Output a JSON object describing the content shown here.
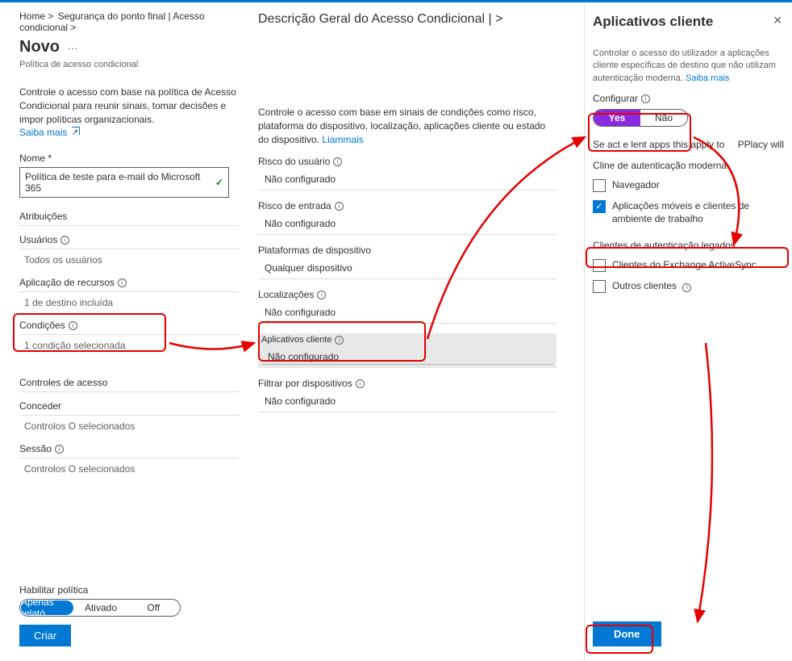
{
  "breadcrumb": {
    "home": "Home >",
    "seg": "Segurança do ponto final | Acesso condicional >",
    "overview": "Descrição Geral do Acesso Condicional | >"
  },
  "header": {
    "novo": "Novo",
    "more": "···",
    "subtitle": "Política de acesso condicional"
  },
  "left": {
    "intro": "Controle o acesso com base na política de Acesso Condicional para reunir sinais, tomar decisões e impor políticas organizacionais.",
    "learn": "Saiba mais",
    "name_label": "Nome *",
    "name_value": "Política de teste para e-mail do Microsoft 365",
    "atrib": "Atribuições",
    "users_t": "Usuários",
    "users_v": "Todos os usuários",
    "app_t": "Aplicação de recursos",
    "app_v": "1 de destino incluída",
    "cond_t": "Condições",
    "cond_v": "1 condição selecionada",
    "acc": "Controles de acesso",
    "grant_t": "Conceder",
    "grant_v": "Controlos O selecionados",
    "sess_t": "Sessão",
    "sess_v": "Controlos O selecionados"
  },
  "mid": {
    "intro": "Controle o acesso com base em sinais de condições como risco, plataforma do dispositivo, localização, aplicações cliente ou estado do dispositivo.",
    "learn": "Liammais",
    "risk_u_t": "Risco do usuário",
    "risk_u_v": "Não configurado",
    "risk_s_t": "Risco de entrada",
    "risk_s_v": "Não configurado",
    "plat_t": "Plataformas de dispositivo",
    "plat_v": "Qualquer dispositivo",
    "loc_t": "Localizações",
    "loc_v": "Não configurado",
    "client_t": "Aplicativos cliente",
    "client_v": "Não configurado",
    "filter_t": "Filtrar por dispositivos",
    "filter_v": "Não configurado"
  },
  "right": {
    "title": "Aplicativos cliente",
    "desc": "Controlar o acesso do utilizador a aplicações cliente específicas de destino que não utilizam autenticação moderna.",
    "learn": "Saiba mais",
    "cfg_label": "Configurar",
    "yes": "Yes",
    "no": "Não",
    "apply_l": "Se act e lent apps this apply to",
    "apply_r": "PPlacy will",
    "modern": "Cline de autenticação moderna",
    "cb_browser": "Navegador",
    "cb_mobile": "Aplicações móveis e clientes de ambiente de trabalho",
    "legacy": "Clientes de autenticação legados",
    "cb_eas": "Clientes do Exchange ActiveSync",
    "cb_other": "Outros clientes",
    "done": "Done"
  },
  "bottom": {
    "enable": "Habilitar política",
    "opt1": "Apenas relató",
    "opt2": "Ativado",
    "opt3": "Off",
    "create": "Criar"
  }
}
